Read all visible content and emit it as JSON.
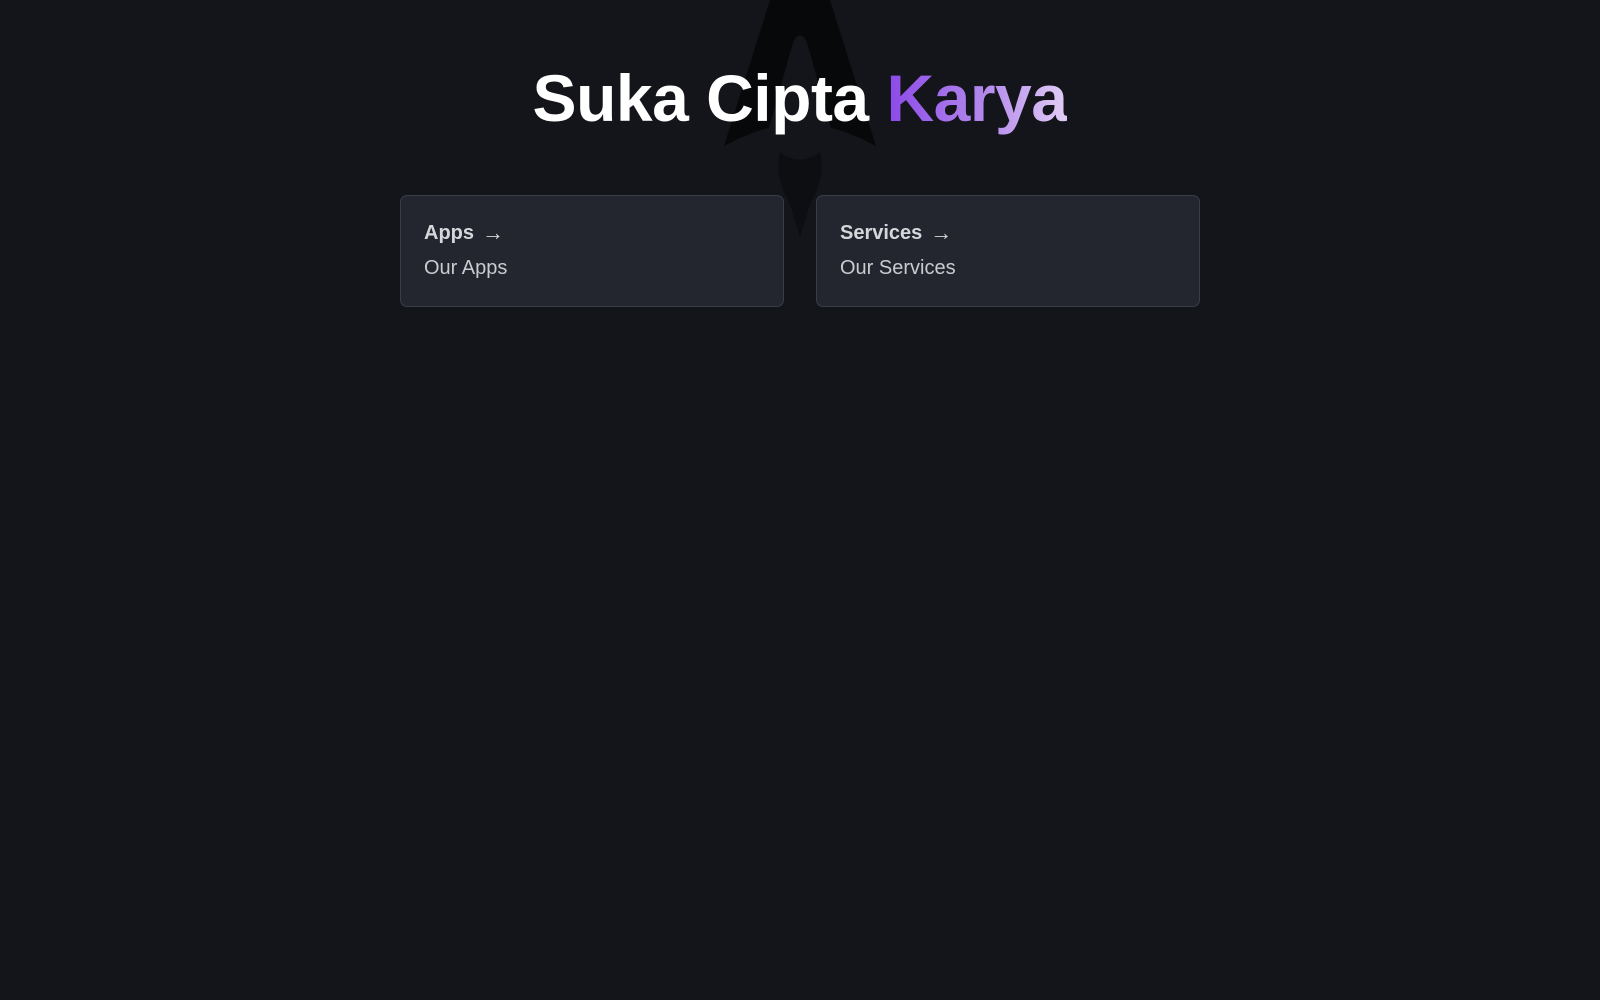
{
  "header": {
    "title_main": "Suka Cipta",
    "title_accent": "Karya"
  },
  "cards": [
    {
      "title": "Apps",
      "arrow": "→",
      "description": "Our Apps"
    },
    {
      "title": "Services",
      "arrow": "→",
      "description": "Our Services"
    }
  ],
  "colors": {
    "background": "#13151a",
    "card_background": "#23262f",
    "card_border": "#3a3d46",
    "title_white": "#ffffff",
    "accent_gradient_start": "#8b48e8",
    "accent_gradient_end": "#e1ccf5"
  },
  "icons": {
    "background_logo": "rocket-icon"
  }
}
